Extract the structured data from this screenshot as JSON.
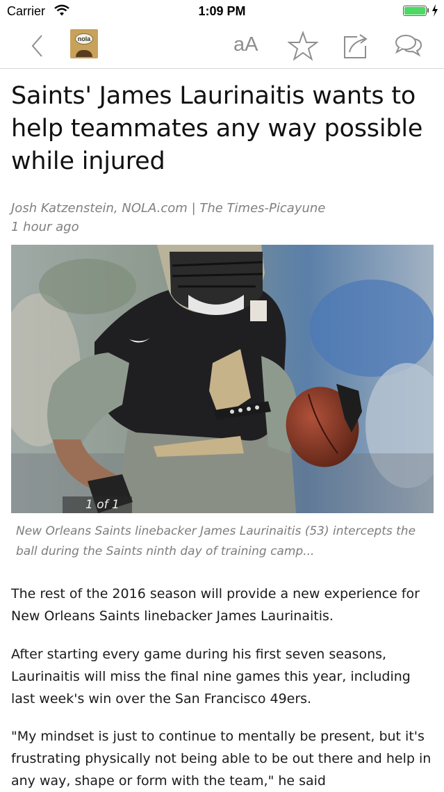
{
  "status_bar": {
    "carrier": "Carrier",
    "time": "1:09 PM",
    "battery_level": 1.0,
    "battery_color": "#4cd964"
  },
  "nav_bar": {
    "back_icon": "chevron-left-icon",
    "logo_text": "nola",
    "text_size_label": "aA",
    "star_icon": "star-icon",
    "share_icon": "share-icon",
    "comments_icon": "comments-icon",
    "icon_color": "#8e8e8e"
  },
  "article": {
    "headline": "Saints' James Laurinaitis wants to help teammates any way possible while injured",
    "byline": "Josh Katzenstein, NOLA.com | The Times-Picayune",
    "timestamp": "1 hour ago",
    "photo": {
      "counter": "1 of 1",
      "caption": "New Orleans Saints linebacker James Laurinaitis (53) intercepts the ball during the Saints ninth day of training camp..."
    },
    "paragraphs": [
      "The rest of the 2016 season will provide a new experience for New Orleans Saints linebacker James Laurinaitis.",
      "After starting every game during his first seven seasons, Laurinaitis will miss the final nine games this year, including last week's win over the San Francisco 49ers.",
      "\"My mindset is just to continue to mentally be present, but it's frustrating physically not being able to be out there and help in any way, shape or form with the team,\" he said"
    ]
  }
}
